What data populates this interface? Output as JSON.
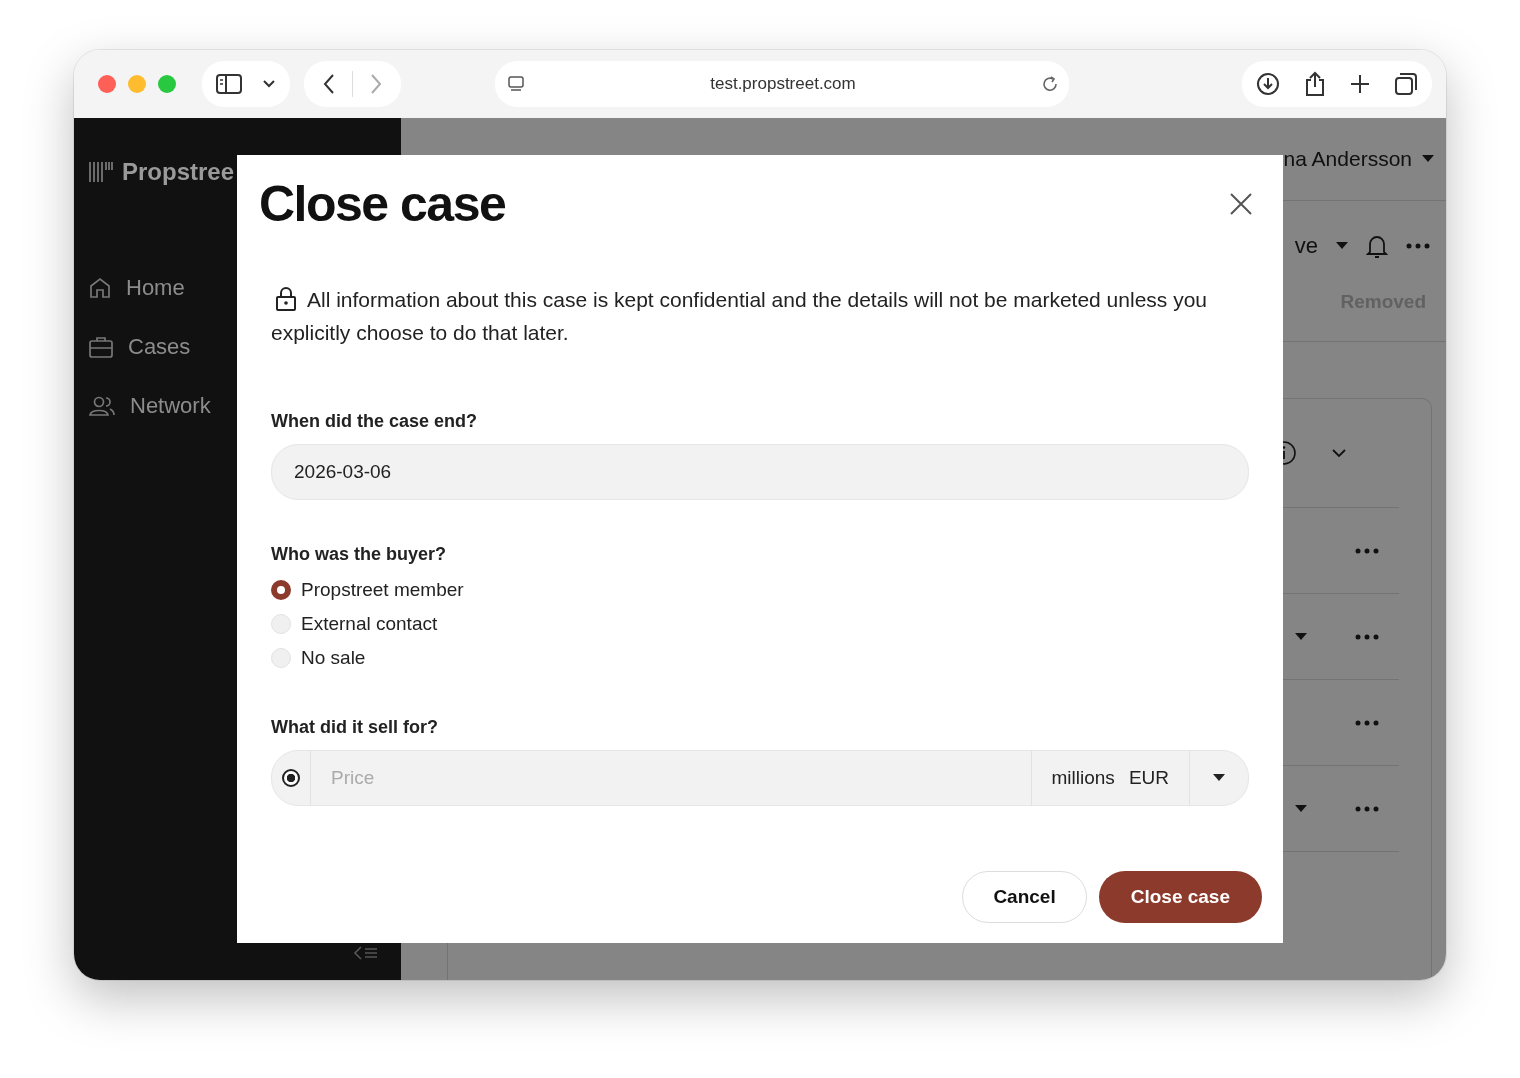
{
  "browser": {
    "url": "test.propstreet.com"
  },
  "sidebar": {
    "logo": "Propstree",
    "items": [
      {
        "label": "Home"
      },
      {
        "label": "Cases"
      },
      {
        "label": "Network"
      }
    ]
  },
  "header": {
    "user": "na Andersson"
  },
  "toolbar": {
    "fragment": "ve"
  },
  "tab_label": "Removed",
  "background_rows": [
    {
      "dropdown": false
    },
    {
      "dropdown": true
    },
    {
      "dropdown": false
    },
    {
      "dropdown": true
    }
  ],
  "modal": {
    "title": "Close case",
    "notice": "All information about this case is kept confidential and the details will not be marketed unless you explicitly choose to do that later.",
    "date": {
      "label": "When did the case end?",
      "value": "2026-03-06"
    },
    "buyer": {
      "label": "Who was the buyer?",
      "options": [
        {
          "label": "Propstreet member",
          "selected": true
        },
        {
          "label": "External contact",
          "selected": false
        },
        {
          "label": "No sale",
          "selected": false
        }
      ]
    },
    "price": {
      "label": "What did it sell for?",
      "selected": true,
      "placeholder": "Price",
      "unit": "millions",
      "currency": "EUR"
    },
    "buttons": [
      {
        "label": "Cancel",
        "kind": "secondary"
      },
      {
        "label": "Close case",
        "kind": "primary"
      }
    ]
  }
}
